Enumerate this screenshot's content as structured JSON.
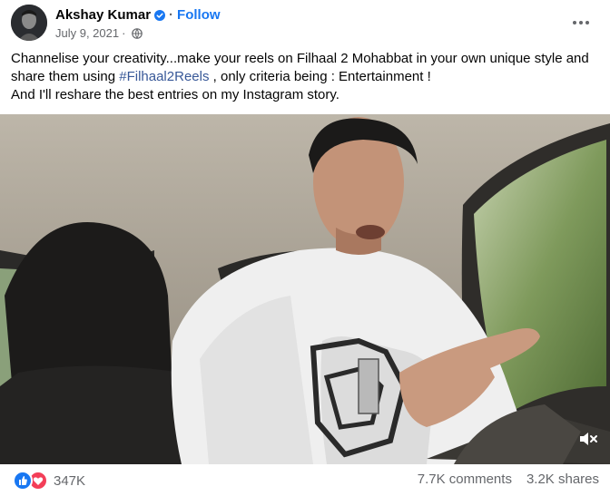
{
  "post": {
    "author": "Akshay Kumar",
    "follow_label": "Follow",
    "separator": "·",
    "date": "July 9, 2021",
    "meta_separator": "·",
    "caption": {
      "text_before_hashtag": "Channelise your creativity...make your reels on Filhaal 2 Mohabbat in your own unique style and share them using ",
      "hashtag": "#Filhaal2Reels",
      "text_after_hashtag": " , only criteria being : Entertainment !",
      "line2": "And I'll reshare the best entries on my Instagram story."
    }
  },
  "icons": {
    "verified": "verified-badge-icon",
    "privacy": "globe-icon",
    "more": "more-options-icon",
    "mute": "speaker-muted-icon",
    "like": "like-reaction-icon",
    "love": "love-reaction-icon"
  },
  "colors": {
    "accent": "#1877f2",
    "hashtag": "#385898",
    "secondary_text": "#65676b",
    "love": "#f33e58"
  },
  "footer": {
    "reaction_count": "347K",
    "comments": "7.7K comments",
    "shares": "3.2K shares"
  }
}
